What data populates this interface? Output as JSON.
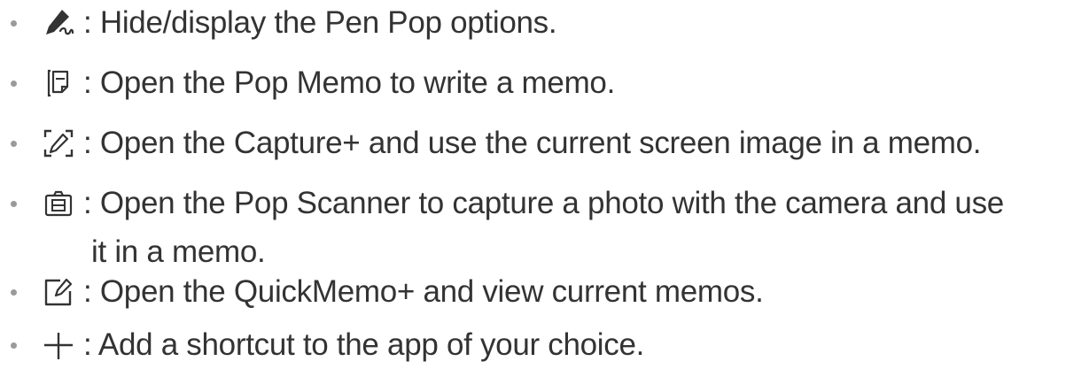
{
  "items": [
    {
      "icon": "pen-pop-icon",
      "text": ": Hide/display the Pen Pop options."
    },
    {
      "icon": "pop-memo-icon",
      "text": ": Open the Pop Memo to write a memo."
    },
    {
      "icon": "capture-plus-icon",
      "text": ": Open the Capture+ and use the current screen image in a memo."
    },
    {
      "icon": "pop-scanner-icon",
      "text": ": Open the Pop Scanner to capture a photo with the camera and use",
      "text_cont": "it in a memo."
    },
    {
      "icon": "quickmemo-plus-icon",
      "text": ": Open the QuickMemo+ and view current memos."
    },
    {
      "icon": "add-shortcut-icon",
      "text": ": Add a shortcut to the app of your choice."
    }
  ],
  "colors": {
    "text": "#333333",
    "icon": "#333333",
    "bullet": "#9a9a9a"
  }
}
